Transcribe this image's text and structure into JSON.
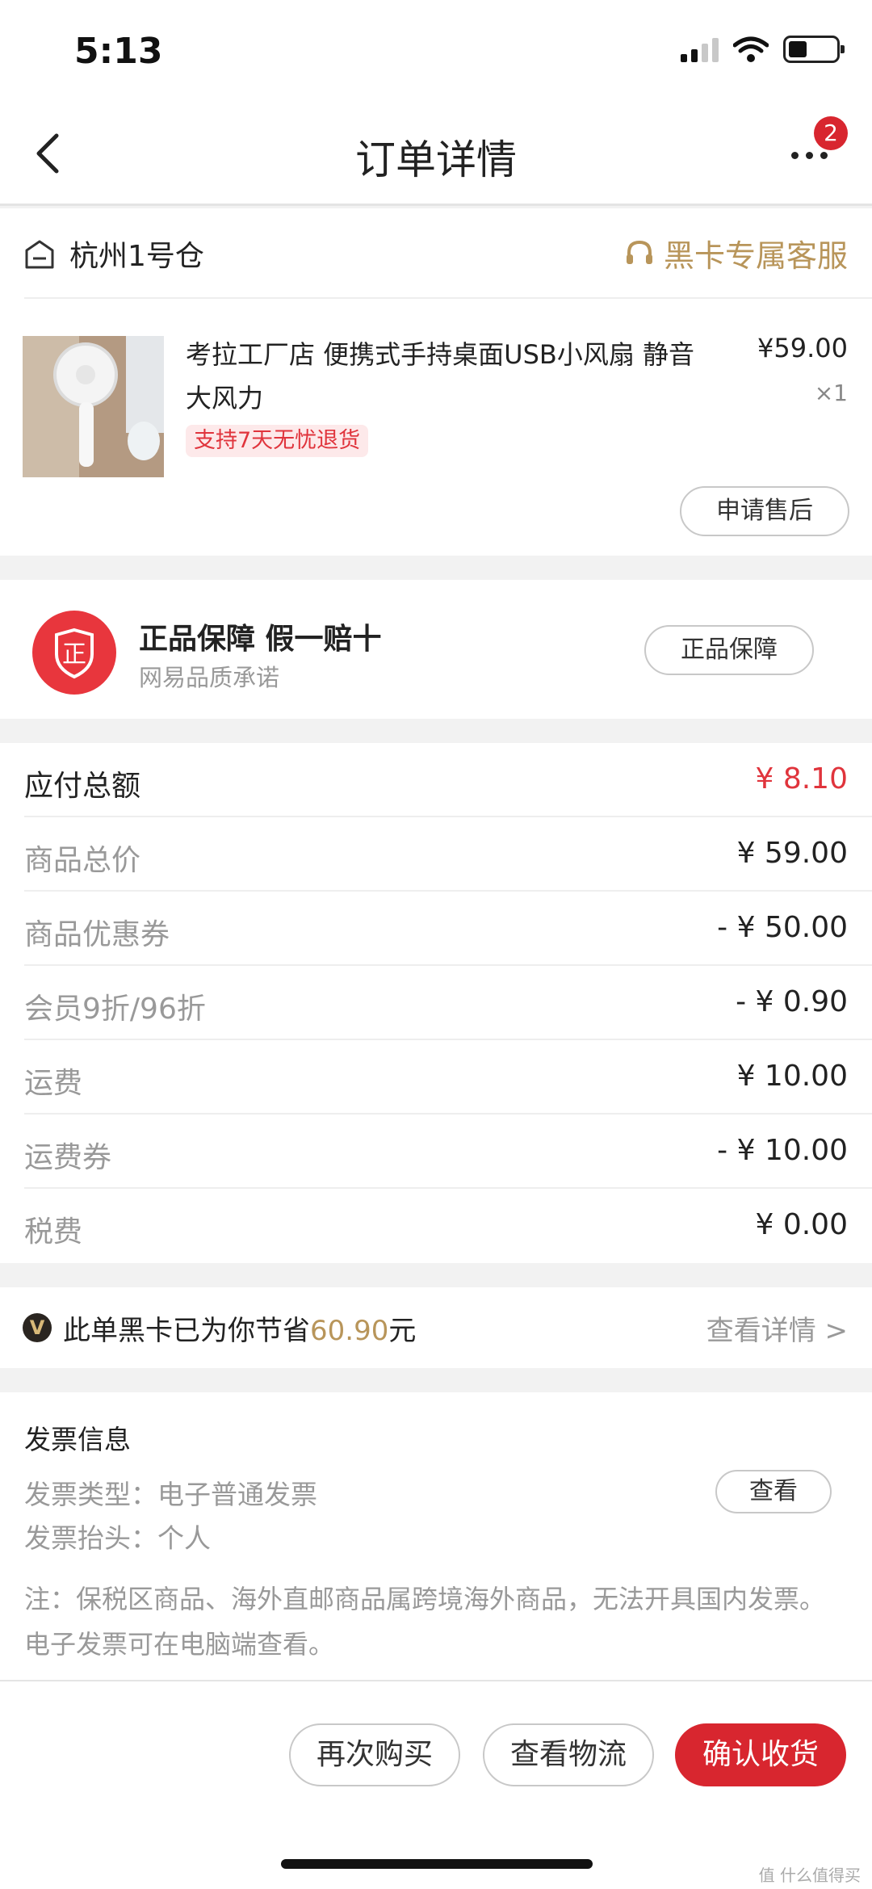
{
  "status_bar": {
    "time": "5:13"
  },
  "nav": {
    "title": "订单详情",
    "badge_count": "2"
  },
  "warehouse": {
    "name": "杭州1号仓",
    "service_label": "黑卡专属客服"
  },
  "product": {
    "title": "考拉工厂店 便携式手持桌面USB小风扇 静音大风力",
    "price": "¥59.00",
    "quantity": "×1",
    "return_tag": "支持7天无忧退货",
    "after_sale_button": "申请售后"
  },
  "guarantee": {
    "seal_char": "正",
    "title": "正品保障  假一赔十",
    "subtitle": "网易品质承诺",
    "button": "正品保障"
  },
  "amounts": [
    {
      "label": "应付总额",
      "value": "¥ 8.10"
    },
    {
      "label": "商品总价",
      "value": "¥ 59.00"
    },
    {
      "label": "商品优惠券",
      "value": "- ¥ 50.00"
    },
    {
      "label": "会员9折/96折",
      "value": "- ¥ 0.90"
    },
    {
      "label": "运费",
      "value": "¥ 10.00"
    },
    {
      "label": "运费券",
      "value": "- ¥ 10.00"
    },
    {
      "label": "税费",
      "value": "¥ 0.00"
    }
  ],
  "saving": {
    "icon_char": "V",
    "prefix": "此单黑卡已为你节省",
    "amount": "60.90",
    "suffix": "元",
    "detail_link": "查看详情 >"
  },
  "invoice": {
    "heading": "发票信息",
    "type": "发票类型：电子普通发票",
    "title": "发票抬头：个人",
    "view_button": "查看",
    "note": "注：保税区商品、海外直邮商品属跨境海外商品，无法开具国内发票。电子发票可在电脑端查看。"
  },
  "bottom_bar": {
    "rebuy": "再次购买",
    "track": "查看物流",
    "confirm": "确认收货"
  },
  "watermark": "值 什么值得买",
  "colors": {
    "accent_red": "#d8262f",
    "gold": "#b8955a"
  }
}
